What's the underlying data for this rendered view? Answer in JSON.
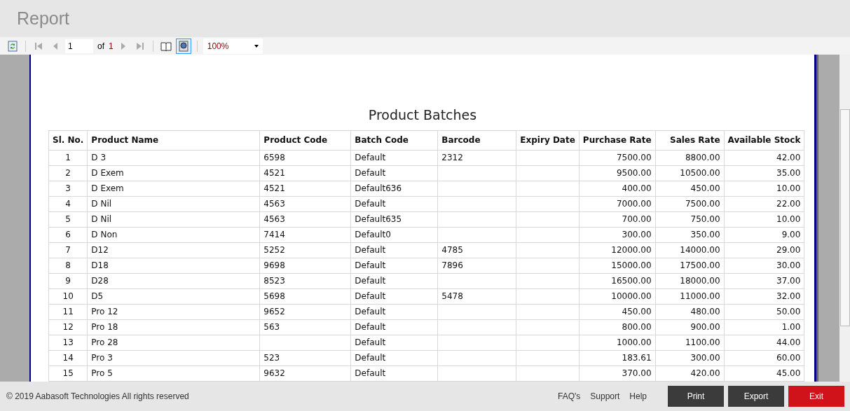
{
  "window": {
    "title": "Report"
  },
  "toolbar": {
    "page": "1",
    "of_label": "of",
    "page_count": "1",
    "zoom": "100%",
    "print_layout_selected": true
  },
  "report": {
    "title": "Product Batches",
    "columns": [
      "Sl. No.",
      "Product Name",
      "Product Code",
      "Batch Code",
      "Barcode",
      "Expiry Date",
      "Purchase Rate",
      "Sales Rate",
      "Available Stock"
    ],
    "rows": [
      [
        "1",
        "D 3",
        "6598",
        "Default",
        "2312",
        "",
        "7500.00",
        "8800.00",
        "42.00"
      ],
      [
        "2",
        "D Exem",
        "4521",
        "Default",
        "",
        "",
        "9500.00",
        "10500.00",
        "35.00"
      ],
      [
        "3",
        "D Exem",
        "4521",
        "Default636",
        "",
        "",
        "400.00",
        "450.00",
        "10.00"
      ],
      [
        "4",
        "D Nil",
        "4563",
        "Default",
        "",
        "",
        "7000.00",
        "7500.00",
        "22.00"
      ],
      [
        "5",
        "D Nil",
        "4563",
        "Default635",
        "",
        "",
        "700.00",
        "750.00",
        "10.00"
      ],
      [
        "6",
        "D Non",
        "7414",
        "Default0",
        "",
        "",
        "300.00",
        "350.00",
        "9.00"
      ],
      [
        "7",
        "D12",
        "5252",
        "Default",
        "4785",
        "",
        "12000.00",
        "14000.00",
        "29.00"
      ],
      [
        "8",
        "D18",
        "9698",
        "Default",
        "7896",
        "",
        "15000.00",
        "17500.00",
        "30.00"
      ],
      [
        "9",
        "D28",
        "8523",
        "Default",
        "",
        "",
        "16500.00",
        "18000.00",
        "37.00"
      ],
      [
        "10",
        "D5",
        "5698",
        "Default",
        "5478",
        "",
        "10000.00",
        "11000.00",
        "32.00"
      ],
      [
        "11",
        "Pro 12",
        "9652",
        "Default",
        "",
        "",
        "450.00",
        "480.00",
        "50.00"
      ],
      [
        "12",
        "Pro 18",
        "563",
        "Default",
        "",
        "",
        "800.00",
        "900.00",
        "1.00"
      ],
      [
        "13",
        "Pro 28",
        "",
        "Default",
        "",
        "",
        "1000.00",
        "1100.00",
        "44.00"
      ],
      [
        "14",
        "Pro 3",
        "523",
        "Default",
        "",
        "",
        "183.61",
        "300.00",
        "60.00"
      ],
      [
        "15",
        "Pro 5",
        "9632",
        "Default",
        "",
        "",
        "370.00",
        "420.00",
        "45.00"
      ]
    ]
  },
  "footer": {
    "copyright": "© 2019 Aabasoft Technologies All rights reserved",
    "links": [
      "FAQ's",
      "Support",
      "Help"
    ],
    "buttons": [
      {
        "label": "Print",
        "kind": "dark"
      },
      {
        "label": "Export",
        "kind": "dark"
      },
      {
        "label": "Exit",
        "kind": "danger"
      }
    ]
  }
}
